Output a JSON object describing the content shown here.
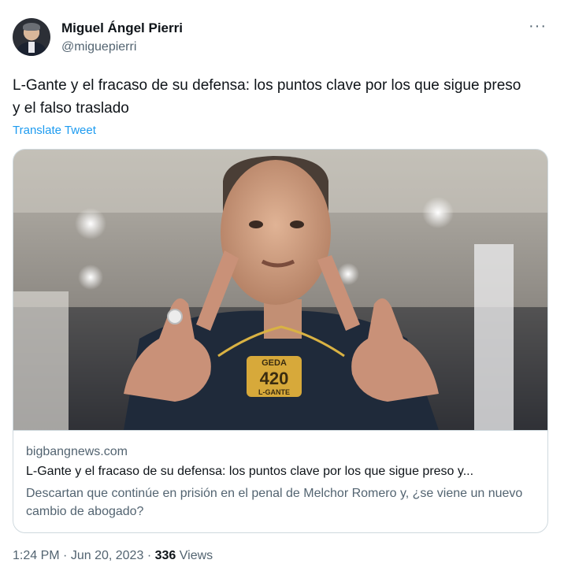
{
  "author": {
    "name": "Miguel Ángel Pierri",
    "handle": "@miguepierri"
  },
  "tweet": {
    "text": "L-Gante y el fracaso de su defensa: los puntos clave por los que sigue preso y el falso traslado",
    "translate_label": "Translate Tweet",
    "more_label": "···"
  },
  "card": {
    "domain": "bigbangnews.com",
    "title": "L-Gante y el fracaso de su defensa: los puntos clave por los que sigue preso y...",
    "description": "Descartan que continúe en prisión en el penal de Melchor Romero y, ¿se viene un nuevo cambio de abogado?",
    "pendant_text_top": "GEDA",
    "pendant_text_number": "420",
    "pendant_text_bottom": "L-GANTE"
  },
  "meta": {
    "time": "1:24 PM",
    "separator": "·",
    "date": "Jun 20, 2023",
    "views_count": "336",
    "views_label": "Views"
  }
}
